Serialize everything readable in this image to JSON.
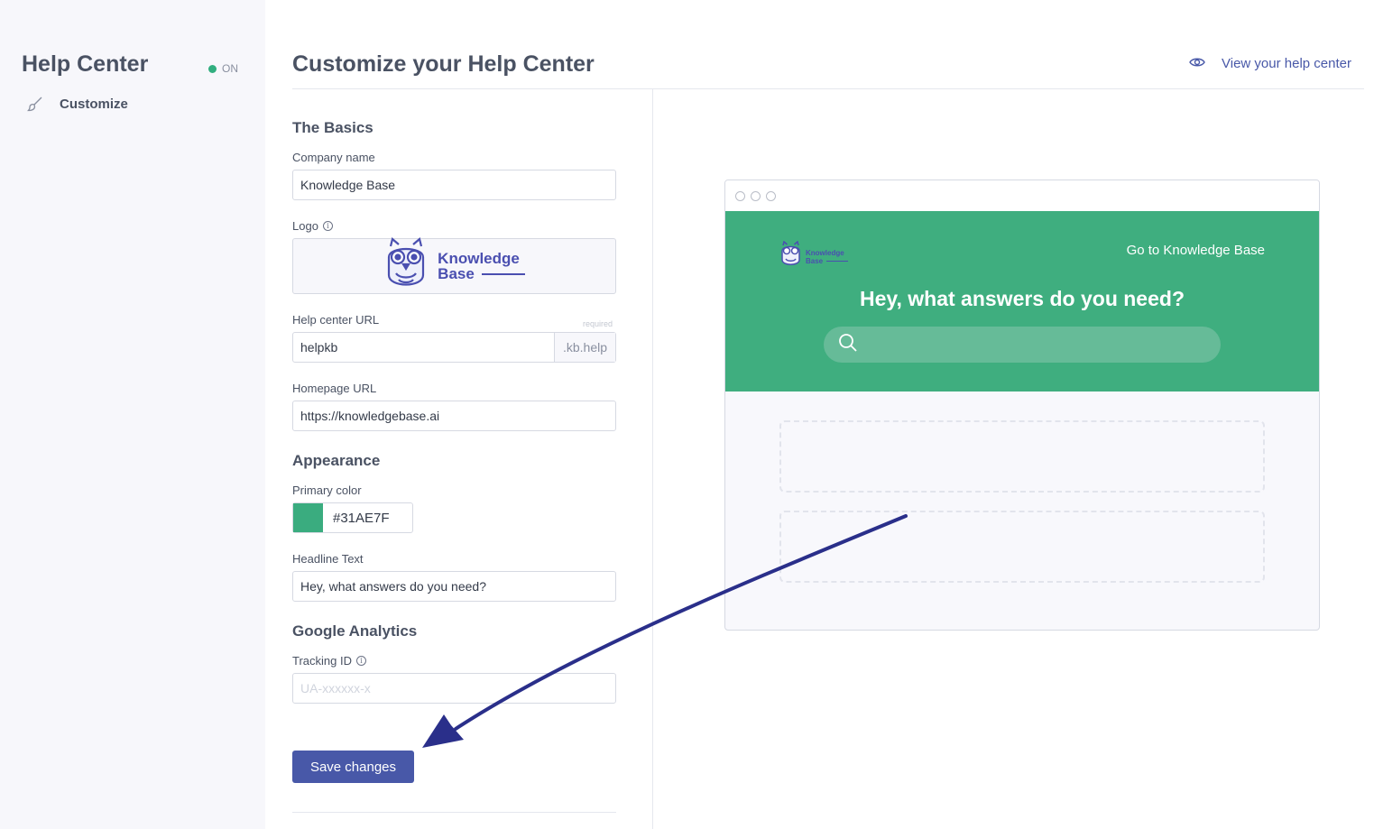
{
  "sidebar": {
    "title": "Help Center",
    "status": "ON",
    "status_color": "#31ae7f",
    "items": [
      {
        "label": "Customize",
        "icon": "brush-icon"
      }
    ]
  },
  "header": {
    "title": "Customize your Help Center",
    "view_link": "View your help center",
    "view_icon": "eye-icon"
  },
  "form": {
    "basics": {
      "title": "The Basics",
      "company_name_label": "Company name",
      "company_name_value": "Knowledge Base",
      "logo_label": "Logo",
      "logo_text_line1": "Knowledge",
      "logo_text_line2": "Base",
      "url_label": "Help center URL",
      "url_required": "required",
      "url_value": "helpkb",
      "url_suffix": ".kb.help",
      "homepage_label": "Homepage URL",
      "homepage_value": "https://knowledgebase.ai"
    },
    "appearance": {
      "title": "Appearance",
      "primary_color_label": "Primary color",
      "primary_color_value": "#31AE7F",
      "headline_label": "Headline Text",
      "headline_value": "Hey, what answers do you need?"
    },
    "analytics": {
      "title": "Google Analytics",
      "tracking_label": "Tracking ID",
      "tracking_placeholder": "UA-xxxxxx-x",
      "tracking_value": ""
    },
    "save_label": "Save changes"
  },
  "preview": {
    "logo_line1": "Knowledge",
    "logo_line2": "Base",
    "goto_link": "Go to Knowledge Base",
    "headline": "Hey, what answers do you need?",
    "hero_color": "#3fae7f"
  },
  "colors": {
    "accent": "#4858a8",
    "arrow": "#2a2f8a"
  }
}
